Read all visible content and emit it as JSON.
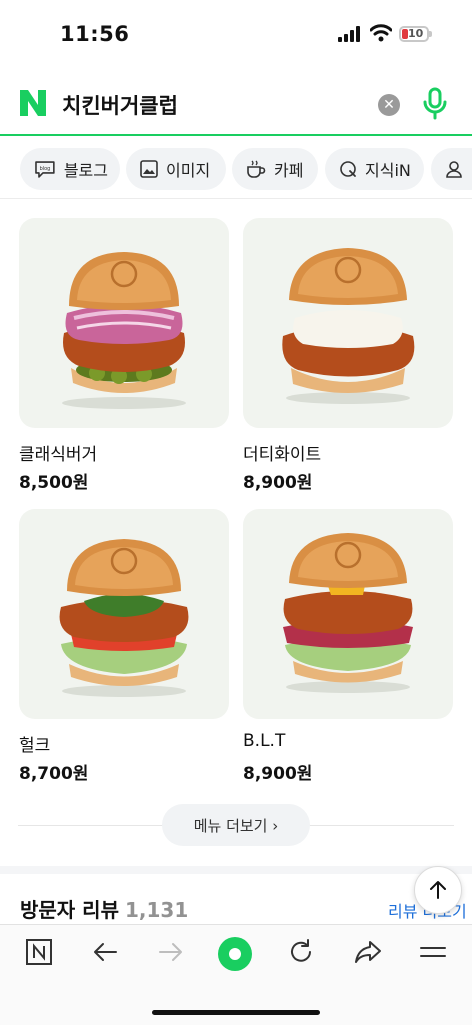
{
  "status": {
    "time": "11:56",
    "battery": "10"
  },
  "search": {
    "query": "치킨버거클럽"
  },
  "tabs": [
    {
      "label": "블로그",
      "icon": "blog-icon"
    },
    {
      "label": "이미지",
      "icon": "image-icon"
    },
    {
      "label": "카페",
      "icon": "cafe-icon"
    },
    {
      "label": "지식iN",
      "icon": "knowledge-icon"
    },
    {
      "label": "",
      "icon": "person-icon"
    }
  ],
  "menu": [
    {
      "name": "클래식버거",
      "price": "8,500원"
    },
    {
      "name": "더티화이트",
      "price": "8,900원"
    },
    {
      "name": "헐크",
      "price": "8,700원"
    },
    {
      "name": "B.L.T",
      "price": "8,900원"
    }
  ],
  "more_label": "메뉴 더보기 ›",
  "reviews": {
    "title": "방문자 리뷰",
    "count": "1,131",
    "link": "리뷰 더보기"
  },
  "colors": {
    "naver_green": "#19ce60",
    "link_blue": "#1e6fd9",
    "battery_red": "#e0393e"
  }
}
